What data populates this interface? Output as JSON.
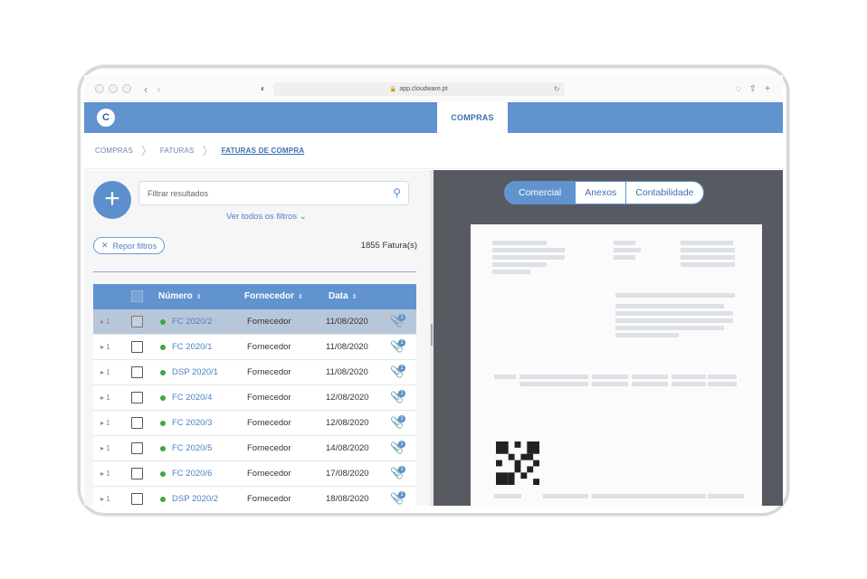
{
  "browser": {
    "url": "app.cloudware.pt"
  },
  "header": {
    "logo_letter": "C",
    "active_tab": "COMPRAS"
  },
  "breadcrumb": {
    "items": [
      "COMPRAS",
      "FATURAS",
      "FATURAS DE COMPRA"
    ]
  },
  "left_panel": {
    "add_label": "+",
    "filter_placeholder": "Filtrar resultados",
    "all_filters_label": "Ver todos os filtros",
    "reset_label": "Repor filtros",
    "count_label": "1855 Fatura(s)"
  },
  "table": {
    "headers": [
      "Número",
      "Fornecedor",
      "Data"
    ],
    "rows": [
      {
        "expand": "1",
        "numero": "FC 2020/2",
        "fornecedor": "Fornecedor",
        "data": "11/08/2020",
        "attachments": "1",
        "selected": true
      },
      {
        "expand": "1",
        "numero": "FC 2020/1",
        "fornecedor": "Fornecedor",
        "data": "11/08/2020",
        "attachments": "1",
        "selected": false
      },
      {
        "expand": "1",
        "numero": "DSP 2020/1",
        "fornecedor": "Fornecedor",
        "data": "11/08/2020",
        "attachments": "1",
        "selected": false
      },
      {
        "expand": "1",
        "numero": "FC 2020/4",
        "fornecedor": "Fornecedor",
        "data": "12/08/2020",
        "attachments": "1",
        "selected": false
      },
      {
        "expand": "1",
        "numero": "FC 2020/3",
        "fornecedor": "Fornecedor",
        "data": "12/08/2020",
        "attachments": "1",
        "selected": false
      },
      {
        "expand": "1",
        "numero": "FC 2020/5",
        "fornecedor": "Fornecedor",
        "data": "14/08/2020",
        "attachments": "1",
        "selected": false
      },
      {
        "expand": "1",
        "numero": "FC 2020/6",
        "fornecedor": "Fornecedor",
        "data": "17/08/2020",
        "attachments": "1",
        "selected": false
      },
      {
        "expand": "1",
        "numero": "DSP 2020/2",
        "fornecedor": "Fornecedor",
        "data": "18/08/2020",
        "attachments": "1",
        "selected": false
      }
    ]
  },
  "right_panel": {
    "tabs": [
      "Comercial",
      "Anexos",
      "Contabilidade"
    ],
    "active_tab": "Comercial"
  },
  "colors": {
    "brand_blue": "#6193cf",
    "status_green": "#3fa646",
    "viewer_bg": "#575b61"
  }
}
